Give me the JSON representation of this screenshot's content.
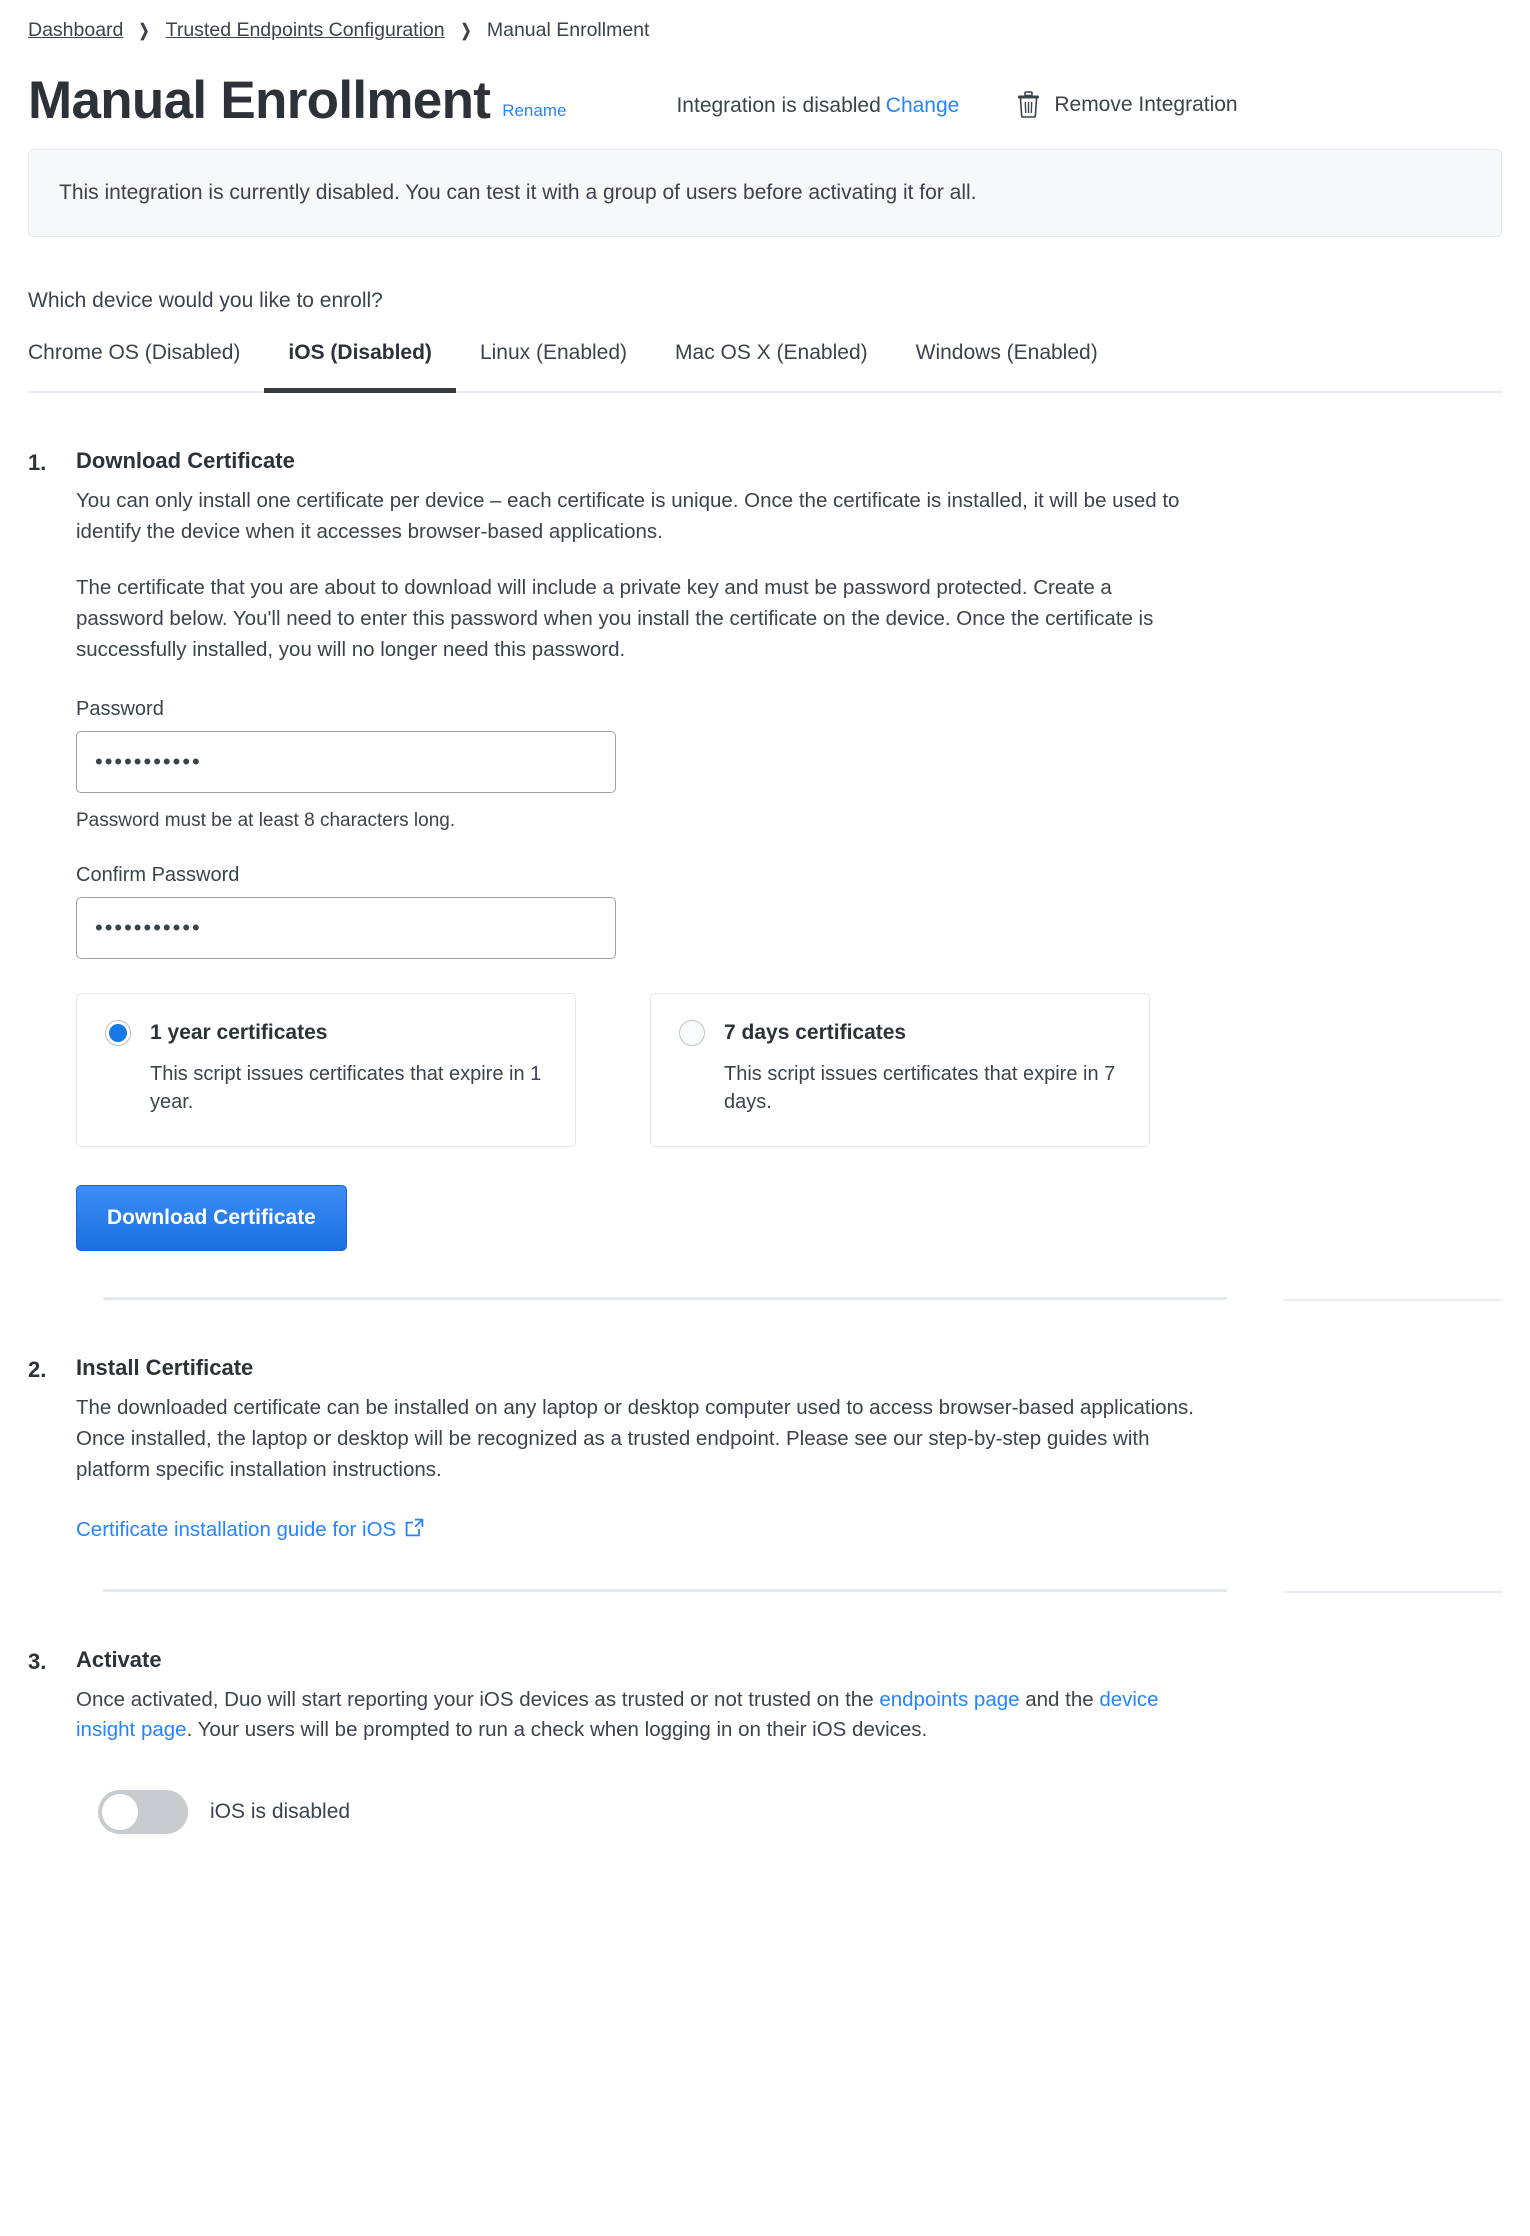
{
  "breadcrumb": {
    "items": [
      {
        "label": "Dashboard",
        "link": true
      },
      {
        "label": "Trusted Endpoints Configuration",
        "link": true
      },
      {
        "label": "Manual Enrollment",
        "link": false
      }
    ],
    "separator": "❯"
  },
  "header": {
    "title": "Manual Enrollment",
    "rename_label": "Rename",
    "integration_status": "Integration is disabled",
    "change_label": "Change",
    "remove_label": "Remove Integration"
  },
  "alert": {
    "message": "This integration is currently disabled. You can test it with a group of users before activating it for all."
  },
  "device_picker": {
    "question": "Which device would you like to enroll?",
    "tabs": [
      {
        "label": "Chrome OS (Disabled)",
        "active": false
      },
      {
        "label": "iOS (Disabled)",
        "active": true
      },
      {
        "label": "Linux (Enabled)",
        "active": false
      },
      {
        "label": "Mac OS X (Enabled)",
        "active": false
      },
      {
        "label": "Windows (Enabled)",
        "active": false
      }
    ]
  },
  "steps": {
    "step1": {
      "number": "1.",
      "title": "Download Certificate",
      "paragraph1": "You can only install one certificate per device – each certificate is unique. Once the certificate is installed, it will be used to identify the device when it accesses browser-based applications.",
      "paragraph2": "The certificate that you are about to download will include a private key and must be password protected. Create a password below. You'll need to enter this password when you install the certificate on the device. Once the certificate is successfully installed, you will no longer need this password.",
      "password_label": "Password",
      "password_value": "•••••••••••",
      "password_placeholder": "",
      "password_help": "Password must be at least 8 characters long.",
      "confirm_label": "Confirm Password",
      "confirm_value": "•••••••••••",
      "confirm_placeholder": "",
      "options": [
        {
          "title": "1 year certificates",
          "description": "This script issues certificates that expire in 1 year.",
          "selected": true
        },
        {
          "title": "7 days certificates",
          "description": "This script issues certificates that expire in 7 days.",
          "selected": false
        }
      ],
      "download_button": "Download Certificate"
    },
    "step2": {
      "number": "2.",
      "title": "Install Certificate",
      "paragraph1": "The downloaded certificate can be installed on any laptop or desktop computer used to access browser-based applications. Once installed, the laptop or desktop will be recognized as a trusted endpoint. Please see our step-by-step guides with platform specific installation instructions.",
      "guide_link": "Certificate installation guide for iOS"
    },
    "step3": {
      "number": "3.",
      "title": "Activate",
      "text_before": "Once activated, Duo will start reporting your iOS devices as trusted or not trusted on the ",
      "link1": "endpoints page",
      "text_middle": " and the ",
      "link2": "device insight page",
      "text_after": ". Your users will be prompted to run a check when logging in on their iOS devices.",
      "toggle_label": "iOS is disabled",
      "toggle_on": false
    }
  },
  "colors": {
    "accent_blue": "#2684ff",
    "button_blue": "#1a6fe0",
    "radio_blue": "#1779e8",
    "text_dark": "#2d3239",
    "text_body": "#3c434d",
    "alert_bg": "#f6f8fa",
    "divider": "#e4e9f0",
    "toggle_off": "#c8ccce",
    "tab_active_underline": "#343b45"
  }
}
